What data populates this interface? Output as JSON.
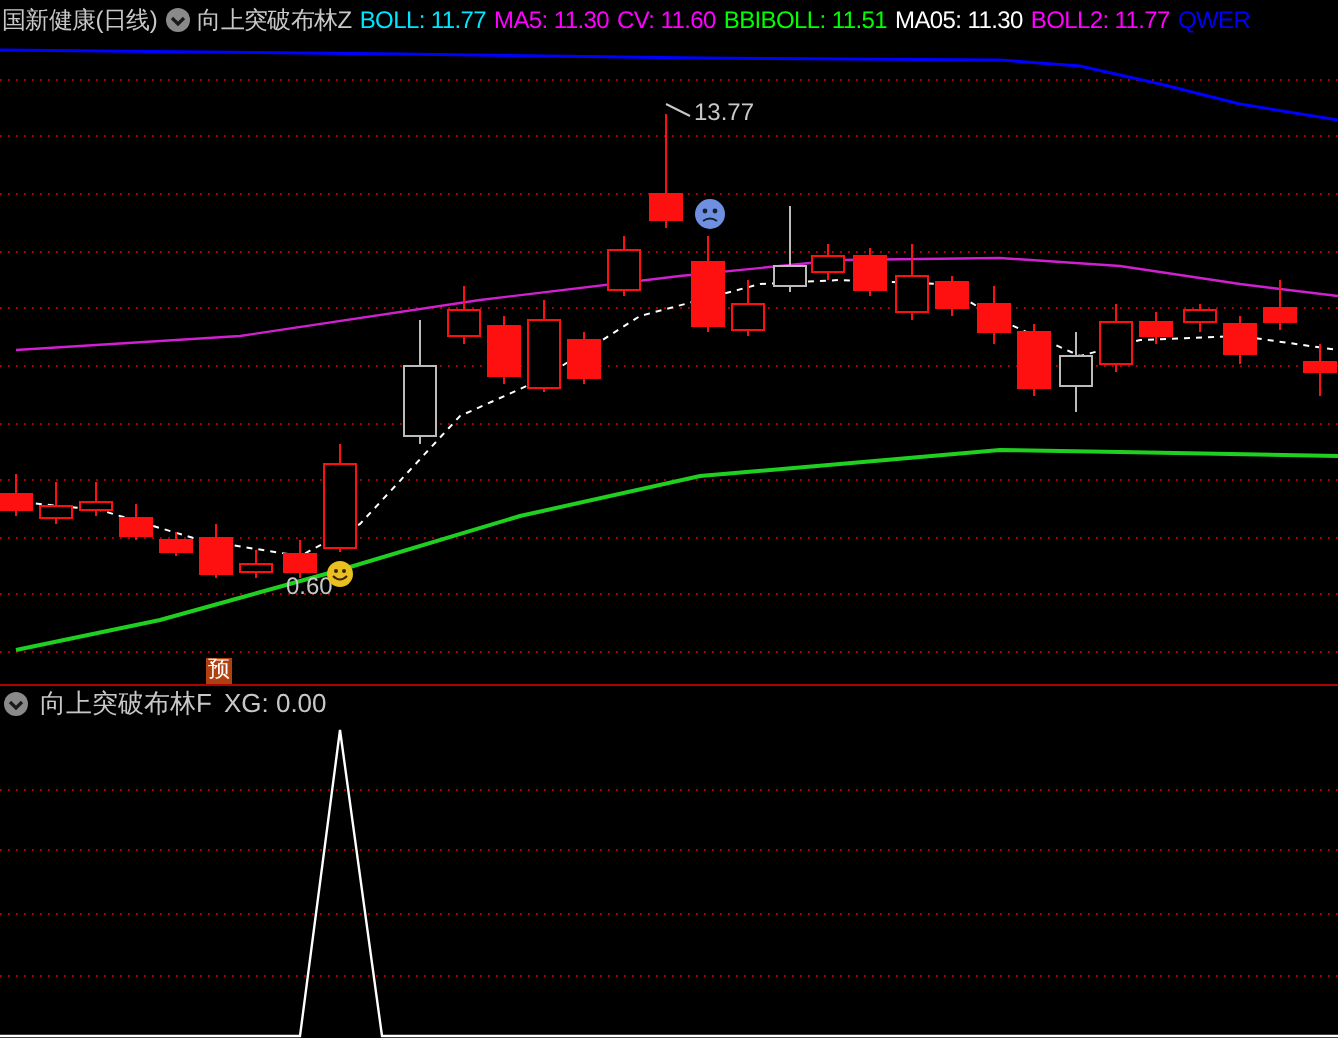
{
  "main_panel": {
    "stock_name": "国新健康(日线)",
    "indicator_name": "向上突破布林Z",
    "indicators": [
      {
        "label": "BOLL: 11.77",
        "color": "#00e5ff"
      },
      {
        "label": "MA5: 11.30",
        "color": "#ff00ff"
      },
      {
        "label": "CV: 11.60",
        "color": "#ff00ff"
      },
      {
        "label": "BBIBOLL: 11.51",
        "color": "#00ff00"
      },
      {
        "label": "MA05: 11.30",
        "color": "#ffffff"
      },
      {
        "label": "BOLL2: 11.77",
        "color": "#ff00ff"
      },
      {
        "label": "QWER",
        "color": "#0000ff"
      }
    ],
    "high_label": "13.77",
    "low_label": "0.60",
    "signal_badge": "预"
  },
  "sub_panel": {
    "indicator_name": "向上突破布林F",
    "reading": "XG: 0.00"
  }
}
